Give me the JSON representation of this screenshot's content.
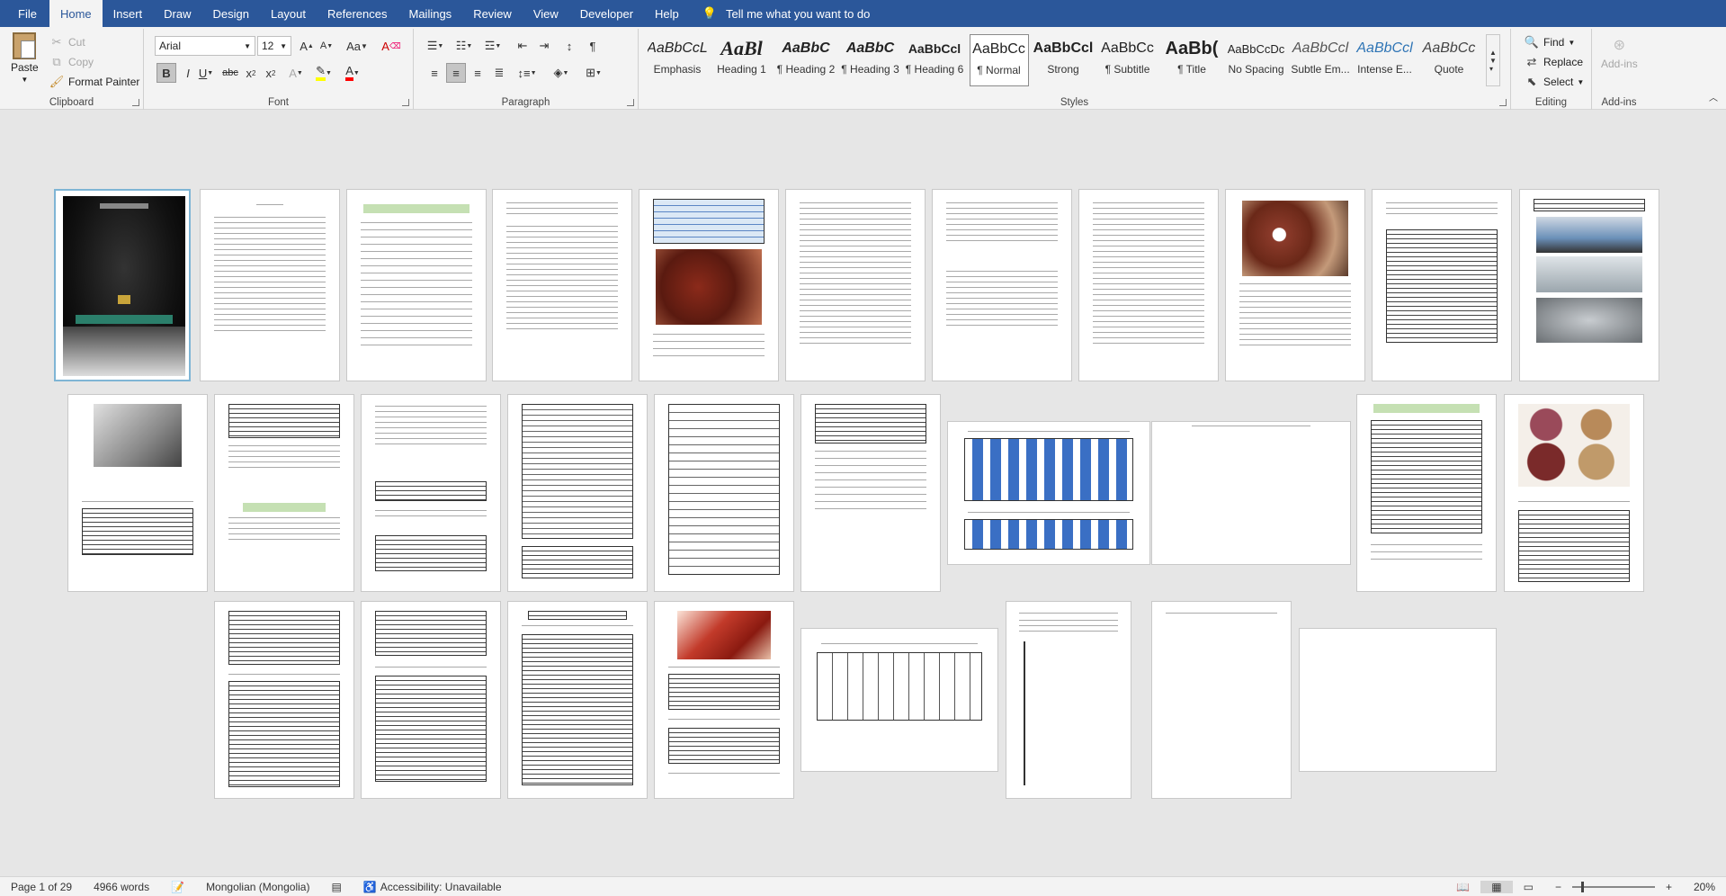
{
  "tabs": [
    "File",
    "Home",
    "Insert",
    "Draw",
    "Design",
    "Layout",
    "References",
    "Mailings",
    "Review",
    "View",
    "Developer",
    "Help"
  ],
  "active_tab": "Home",
  "tell_me": "Tell me what you want to do",
  "clipboard": {
    "paste": "Paste",
    "cut": "Cut",
    "copy": "Copy",
    "format_painter": "Format Painter",
    "label": "Clipboard"
  },
  "font": {
    "name": "Arial",
    "size": "12",
    "label": "Font"
  },
  "paragraph": {
    "label": "Paragraph"
  },
  "styles": {
    "label": "Styles",
    "items": [
      {
        "preview": "AaBbCcL",
        "name": "Emphasis"
      },
      {
        "preview": "AaBl",
        "name": "Heading 1"
      },
      {
        "preview": "AaBbC",
        "name": "¶ Heading 2"
      },
      {
        "preview": "AaBbC",
        "name": "¶ Heading 3"
      },
      {
        "preview": "AaBbCcl",
        "name": "¶ Heading 6"
      },
      {
        "preview": "AaBbCc",
        "name": "¶ Normal"
      },
      {
        "preview": "AaBbCcl",
        "name": "Strong"
      },
      {
        "preview": "AaBbCc",
        "name": "¶ Subtitle"
      },
      {
        "preview": "AaBb(",
        "name": "¶ Title"
      },
      {
        "preview": "AaBbCcDc",
        "name": "No Spacing"
      },
      {
        "preview": "AaBbCcl",
        "name": "Subtle Em..."
      },
      {
        "preview": "AaBbCcl",
        "name": "Intense E..."
      },
      {
        "preview": "AaBbCc",
        "name": "Quote"
      }
    ]
  },
  "editing": {
    "find": "Find",
    "replace": "Replace",
    "select": "Select",
    "label": "Editing"
  },
  "addins": {
    "button": "Add-ins",
    "label": "Add-ins"
  },
  "status": {
    "page": "Page 1 of 29",
    "words": "4966 words",
    "language": "Mongolian (Mongolia)",
    "accessibility": "Accessibility: Unavailable",
    "zoom": "20%"
  },
  "colors": {
    "titlebar": "#2b579a",
    "ribbon": "#f3f3f3",
    "canvas": "#e6e6e6",
    "highlight": "#ffff00",
    "fontcolor": "#ff0000"
  }
}
